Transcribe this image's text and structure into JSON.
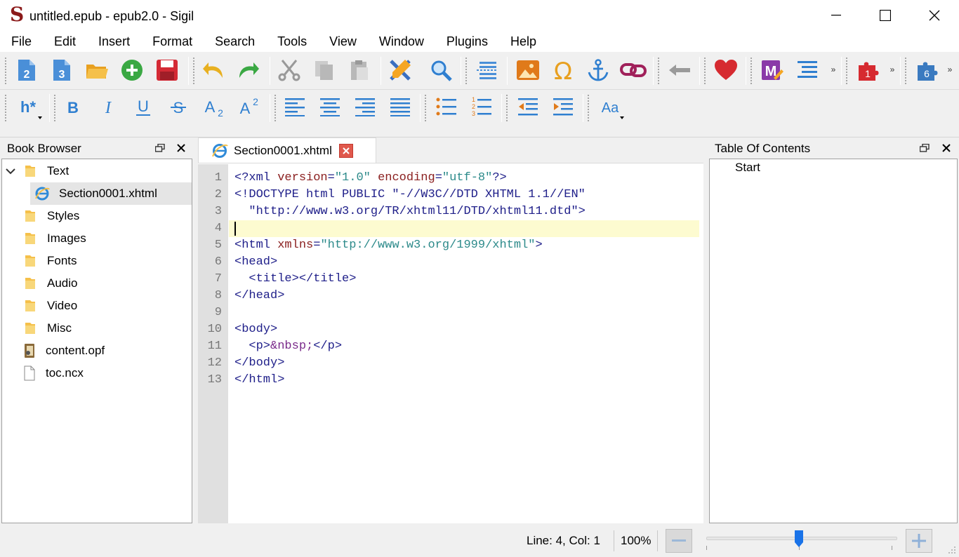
{
  "window": {
    "title": "untitled.epub - epub2.0 - Sigil",
    "logo_glyph": "S"
  },
  "menu": [
    "File",
    "Edit",
    "Insert",
    "Format",
    "Search",
    "Tools",
    "View",
    "Window",
    "Plugins",
    "Help"
  ],
  "toolbar1": {
    "icons": [
      "new-epub2-icon",
      "new-epub3-icon",
      "open-icon",
      "add-file-icon",
      "save-icon",
      "undo-icon",
      "redo-icon",
      "cut-icon",
      "copy-icon",
      "paste-icon",
      "validate-icon",
      "find-icon",
      "split-icon",
      "insert-image-icon",
      "special-character-icon",
      "anchor-icon",
      "link-icon",
      "back-icon",
      "donate-icon",
      "metadata-editor-icon",
      "toc-editor-icon",
      "plugin-1-icon",
      "plugin-6-icon"
    ],
    "plugin_1_badge": "1",
    "plugin_6_badge": "6",
    "epub2_badge": "2",
    "epub3_badge": "3"
  },
  "toolbar2": {
    "heading_label": "h*",
    "bold": "B",
    "italic": "I",
    "underline": "U",
    "strike": "S",
    "subscript": "A",
    "subscript_sub": "2",
    "superscript": "A",
    "superscript_sup": "2",
    "case_label": "Aa"
  },
  "book_browser": {
    "title": "Book Browser",
    "items": [
      {
        "label": "Text",
        "type": "folder",
        "expanded": true
      },
      {
        "label": "Section0001.xhtml",
        "type": "xhtml",
        "selected": true
      },
      {
        "label": "Styles",
        "type": "folder"
      },
      {
        "label": "Images",
        "type": "folder"
      },
      {
        "label": "Fonts",
        "type": "folder"
      },
      {
        "label": "Audio",
        "type": "folder"
      },
      {
        "label": "Video",
        "type": "folder"
      },
      {
        "label": "Misc",
        "type": "folder"
      },
      {
        "label": "content.opf",
        "type": "opf"
      },
      {
        "label": "toc.ncx",
        "type": "ncx"
      }
    ]
  },
  "editor": {
    "tab_label": "Section0001.xhtml",
    "line_numbers": [
      "1",
      "2",
      "3",
      "4",
      "5",
      "6",
      "7",
      "8",
      "9",
      "10",
      "11",
      "12",
      "13"
    ]
  },
  "toc": {
    "title": "Table Of Contents",
    "items": [
      "Start"
    ]
  },
  "status": {
    "position": "Line: 4, Col: 1",
    "zoom": "100%",
    "zoom_out": "—",
    "zoom_in": "+",
    "zoom_level": 1.0
  }
}
